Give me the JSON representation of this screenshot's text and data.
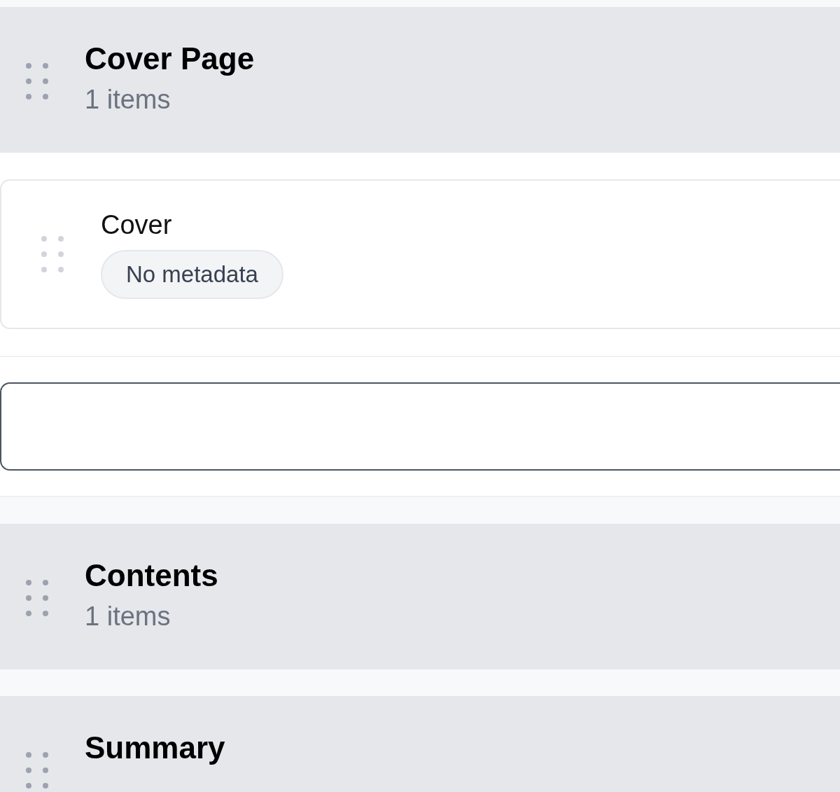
{
  "sections": [
    {
      "title": "Cover Page",
      "count": "1 items",
      "items": [
        {
          "title": "Cover",
          "badge": "No metadata"
        }
      ]
    },
    {
      "title": "Contents",
      "count": "1 items"
    },
    {
      "title": "Summary"
    }
  ]
}
